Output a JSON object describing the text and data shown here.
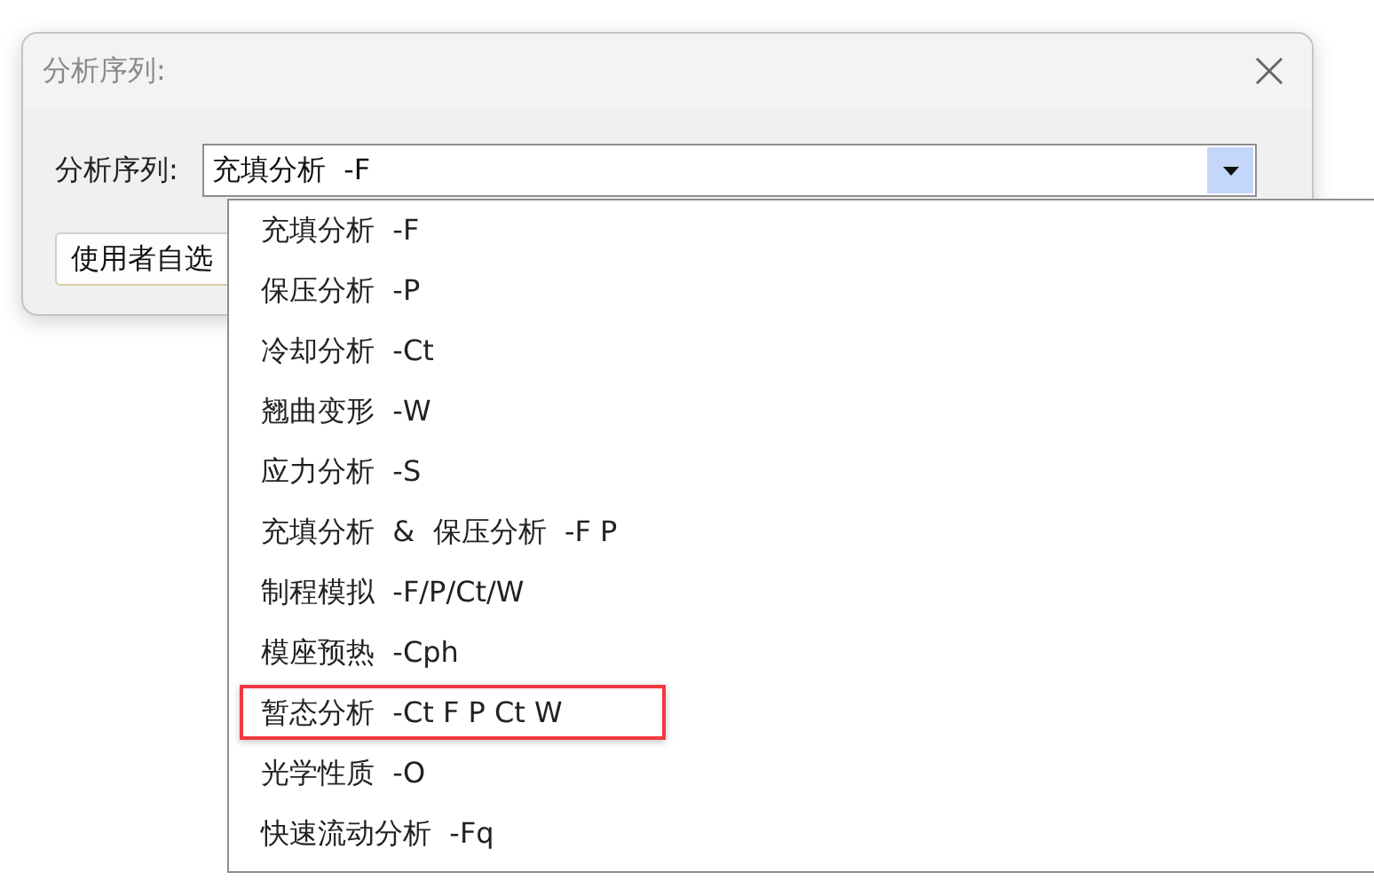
{
  "dialog": {
    "title": "分析序列:"
  },
  "sequence_field": {
    "label": "分析序列:",
    "value": "充填分析  -F",
    "expanded": true
  },
  "custom_button": {
    "label": "使用者自选"
  },
  "options": [
    {
      "label": "充填分析  -F",
      "highlighted": false
    },
    {
      "label": "保压分析  -P",
      "highlighted": false
    },
    {
      "label": "冷却分析  -Ct",
      "highlighted": false
    },
    {
      "label": "翘曲变形  -W",
      "highlighted": false
    },
    {
      "label": "应力分析  -S",
      "highlighted": false
    },
    {
      "label": "充填分析  &  保压分析  -F P",
      "highlighted": false
    },
    {
      "label": "制程模拟  -F/P/Ct/W",
      "highlighted": false
    },
    {
      "label": "模座预热  -Cph",
      "highlighted": false
    },
    {
      "label": "暂态分析  -Ct F P Ct W",
      "highlighted": true
    },
    {
      "label": "光学性质  -O",
      "highlighted": false
    },
    {
      "label": "快速流动分析  -Fq",
      "highlighted": false
    }
  ]
}
